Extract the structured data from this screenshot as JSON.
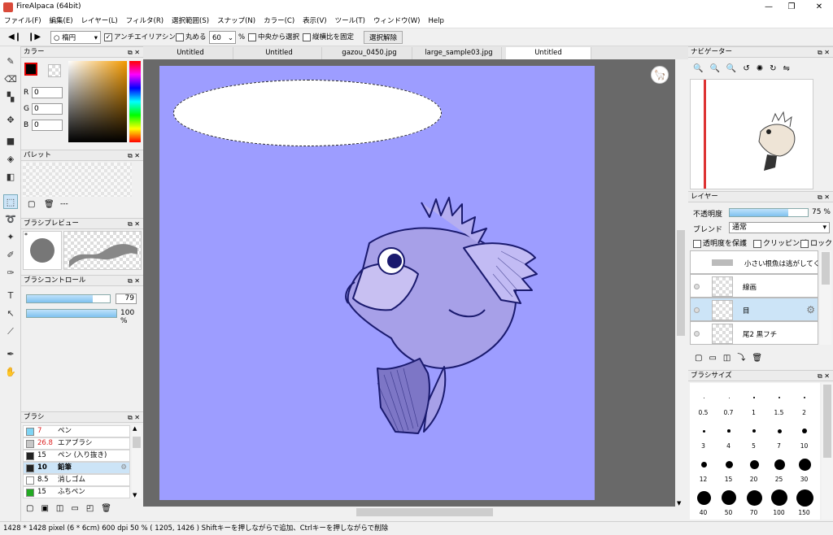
{
  "app": {
    "title": "FireAlpaca (64bit)"
  },
  "menu": [
    "ファイル(F)",
    "編集(E)",
    "レイヤー(L)",
    "フィルタ(R)",
    "選択範囲(S)",
    "スナップ(N)",
    "カラー(C)",
    "表示(V)",
    "ツール(T)",
    "ウィンドウ(W)",
    "Help"
  ],
  "toolbar": {
    "shape": "楕円",
    "antialias": "アンチエイリアシング",
    "round": "丸める",
    "round_value": "60",
    "percent": "%",
    "from_center": "中央から選択",
    "fix_ratio": "縦横比を固定",
    "deselect": "選択解除"
  },
  "tabs": [
    "Untitled",
    "Untitled",
    "gazou_0450.jpg",
    "large_sample03.jpg",
    "Untitled"
  ],
  "color": {
    "title": "カラー",
    "r_label": "R",
    "g_label": "G",
    "b_label": "B",
    "r": "0",
    "g": "0",
    "b": "0",
    "fg": "#000000",
    "canvas": "#9d9dff"
  },
  "palette": {
    "title": "パレット",
    "empty": "---"
  },
  "brush_preview": {
    "title": "ブラシプレビュー",
    "marker": "*"
  },
  "brush_control": {
    "title": "ブラシコントロール",
    "size": "79",
    "opacity": "100 %",
    "size_level": 0.79,
    "opacity_level": 1.0
  },
  "brush": {
    "title": "ブラシ",
    "items": [
      {
        "size": "7",
        "name": "ペン",
        "color": "#7fd4f4",
        "red": true
      },
      {
        "size": "26.8",
        "name": "エアブラシ",
        "color": "#c8c8c8",
        "red": true
      },
      {
        "size": "15",
        "name": "ペン (入り抜き)",
        "color": "#222222",
        "red": false
      },
      {
        "size": "10",
        "name": "鉛筆",
        "color": "#222222",
        "red": false
      },
      {
        "size": "8.5",
        "name": "消しゴム",
        "color": "#ffffff",
        "red": false
      },
      {
        "size": "15",
        "name": "ふちペン",
        "color": "#22aa22",
        "red": false
      }
    ]
  },
  "navigator": {
    "title": "ナビゲーター"
  },
  "layer": {
    "title": "レイヤー",
    "opacity_label": "不透明度",
    "opacity": "75 %",
    "opacity_level": 0.75,
    "blend_label": "ブレンド",
    "blend": "通常",
    "protect": "透明度を保護",
    "clipping": "クリッピング",
    "lock": "ロック",
    "rows": [
      "小さい根魚は逃がしてくれ",
      "線画",
      "目",
      "尾2 黒フチ"
    ]
  },
  "brush_size": {
    "title": "ブラシサイズ",
    "labels": [
      "0.5",
      "0.7",
      "1",
      "1.5",
      "2",
      "3",
      "4",
      "5",
      "7",
      "10",
      "12",
      "15",
      "20",
      "25",
      "30",
      "40",
      "50",
      "70",
      "100",
      "150"
    ]
  },
  "status": {
    "text": "1428 * 1428 pixel  (6 * 6cm)  600 dpi  50 %  ( 1205, 1426 )  Shiftキーを押しながらで追加、Ctrlキーを押しながらで削除"
  }
}
